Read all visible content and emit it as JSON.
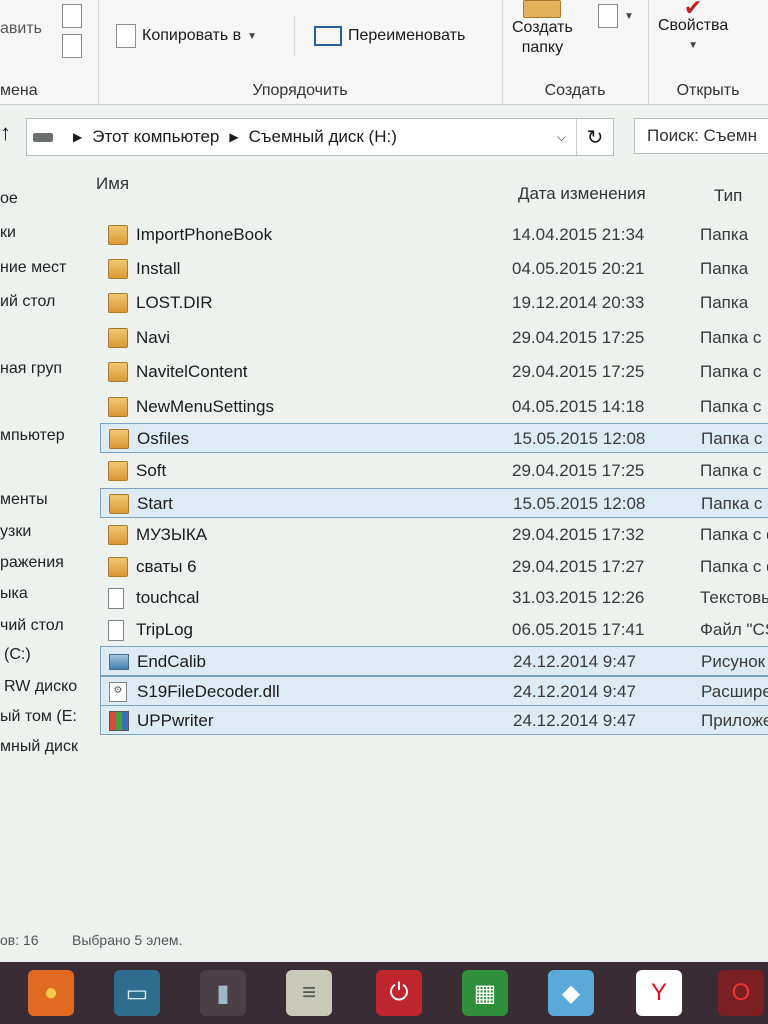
{
  "ribbon": {
    "clipboard": {
      "paste_label": "авить",
      "group_label": "мена"
    },
    "organize": {
      "copy_to_label": "Копировать в",
      "rename_label": "Переименовать",
      "group_label": "Упорядочить"
    },
    "new": {
      "new_folder_label": [
        "Создать",
        "папку"
      ],
      "group_label": "Создать"
    },
    "open": {
      "properties_label": "Свойства",
      "group_label": "Открыть"
    }
  },
  "address": {
    "breadcrumbs": [
      "Этот компьютер",
      "Съемный диск (H:)"
    ],
    "search_placeholder": "Поиск: Съемн"
  },
  "nav": {
    "items": [
      "ое",
      "ки",
      "ние мест",
      "ий стол",
      "ная груп",
      "мпьютер",
      "менты",
      "узки",
      "ражения",
      "ыка",
      "чий стол",
      "(C:)",
      "RW диско",
      "ый том (E:",
      "мный диск"
    ]
  },
  "columns": {
    "name": "Имя",
    "date": "Дата изменения",
    "type": "Тип"
  },
  "files": [
    {
      "name": "ImportPhoneBook",
      "date": "14.04.2015 21:34",
      "type": "Папка",
      "icon": "folder-icon",
      "selected": false
    },
    {
      "name": "Install",
      "date": "04.05.2015 20:21",
      "type": "Папка",
      "icon": "folder-icon",
      "selected": false
    },
    {
      "name": "LOST.DIR",
      "date": "19.12.2014 20:33",
      "type": "Папка",
      "icon": "folder-icon",
      "selected": false
    },
    {
      "name": "Navi",
      "date": "29.04.2015 17:25",
      "type": "Папка с",
      "icon": "folder-icon",
      "selected": false
    },
    {
      "name": "NavitelContent",
      "date": "29.04.2015 17:25",
      "type": "Папка с",
      "icon": "folder-icon",
      "selected": false
    },
    {
      "name": "NewMenuSettings",
      "date": "04.05.2015 14:18",
      "type": "Папка с",
      "icon": "folder-icon",
      "selected": false
    },
    {
      "name": "Osfiles",
      "date": "15.05.2015 12:08",
      "type": "Папка с",
      "icon": "folder-icon",
      "selected": true
    },
    {
      "name": "Soft",
      "date": "29.04.2015 17:25",
      "type": "Папка с",
      "icon": "folder-icon",
      "selected": false
    },
    {
      "name": "Start",
      "date": "15.05.2015 12:08",
      "type": "Папка с ф",
      "icon": "folder-icon",
      "selected": true
    },
    {
      "name": "МУЗЫКА",
      "date": "29.04.2015 17:32",
      "type": "Папка с ф",
      "icon": "folder-icon",
      "selected": false
    },
    {
      "name": "сваты 6",
      "date": "29.04.2015 17:27",
      "type": "Папка с ф",
      "icon": "folder-icon",
      "selected": false
    },
    {
      "name": "touchcal",
      "date": "31.03.2015 12:26",
      "type": "Текстовы",
      "icon": "text-file-icon",
      "selected": false
    },
    {
      "name": "TripLog",
      "date": "06.05.2015 17:41",
      "type": "Файл \"CSV",
      "icon": "text-file-icon",
      "selected": false
    },
    {
      "name": "EndCalib",
      "date": "24.12.2014 9:47",
      "type": "Рисунок JP",
      "icon": "image-file-icon",
      "selected": true
    },
    {
      "name": "S19FileDecoder.dll",
      "date": "24.12.2014 9:47",
      "type": "Расширен",
      "icon": "dll-file-icon",
      "selected": true
    },
    {
      "name": "UPPwriter",
      "date": "24.12.2014 9:47",
      "type": "Приложен",
      "icon": "app-icon",
      "selected": true
    }
  ],
  "status": {
    "items_count": "ов: 16",
    "selected_count": "Выбрано 5 элем."
  },
  "taskbar": {
    "apps": [
      "firefox-icon",
      "computer-icon",
      "usb-icon",
      "notepad-icon",
      "power-icon",
      "store-icon",
      "chat-icon",
      "yandex-icon",
      "opera-icon"
    ]
  }
}
